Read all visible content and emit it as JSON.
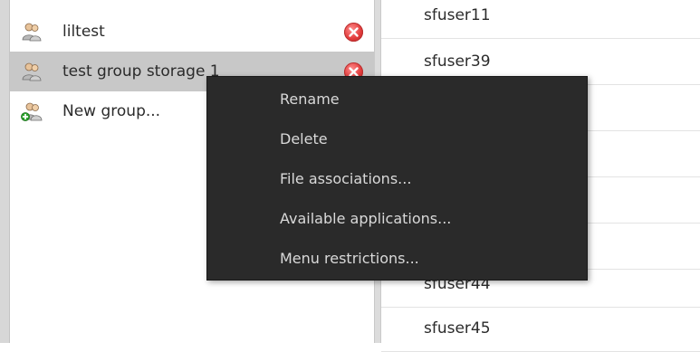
{
  "groups": [
    {
      "name": "liltest"
    },
    {
      "name": "test group storage 1"
    }
  ],
  "new_group_label": "New group...",
  "users": [
    "sfuser11",
    "sfuser39",
    "",
    "",
    "",
    "",
    "sfuser44",
    "sfuser45"
  ],
  "context_menu": {
    "items": [
      {
        "label": "Rename"
      },
      {
        "label": "Delete"
      },
      {
        "label": "File associations..."
      },
      {
        "label": "Available applications..."
      },
      {
        "label": "Menu restrictions..."
      }
    ]
  },
  "colors": {
    "menu_bg": "#2a2a2a",
    "menu_text": "#d9d9d9",
    "selected_row": "#c8c8c8",
    "delete_icon": "#e33c3c"
  }
}
